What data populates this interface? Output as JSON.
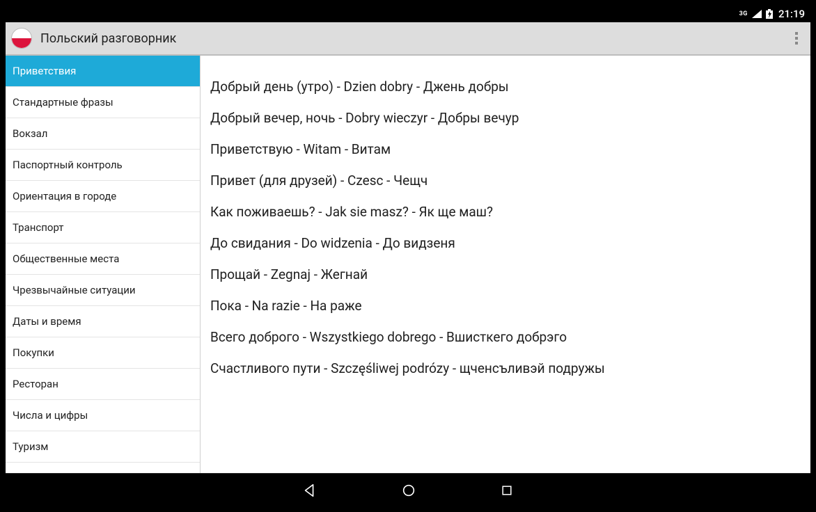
{
  "status": {
    "net_label": "3G",
    "time": "21:19"
  },
  "app": {
    "title": "Польский разговорник"
  },
  "sidebar": {
    "items": [
      {
        "label": "Приветствия",
        "selected": true
      },
      {
        "label": "Стандартные фразы"
      },
      {
        "label": "Вокзал"
      },
      {
        "label": "Паспортный контроль"
      },
      {
        "label": "Ориентация в городе"
      },
      {
        "label": "Транспорт"
      },
      {
        "label": "Общественные места"
      },
      {
        "label": "Чрезвычайные ситуации"
      },
      {
        "label": "Даты и время"
      },
      {
        "label": "Покупки"
      },
      {
        "label": "Ресторан"
      },
      {
        "label": "Числа и цифры"
      },
      {
        "label": "Туризм"
      }
    ]
  },
  "phrases": [
    "Добрый день (утро) - Dzien dobry - Джень добры",
    "Добрый вечер, ночь - Dobry wieczyr - Добры вечур",
    "Приветствую - Witam - Витам",
    "Привет (для друзей) - Czesc - Чещч",
    "Как поживаешь? - Jak sie masz? - Як ще маш?",
    "До свидания - Do widzenia - До видзеня",
    "Прощай - Zegnaj - Жегнай",
    "Пока - Na razie - На раже",
    "Всего доброго - Wszystkiego dobrego - Вшисткего добрэго",
    "Счастливого пути - Szczęśliwej podrózy - щченсъливэй подружы"
  ]
}
